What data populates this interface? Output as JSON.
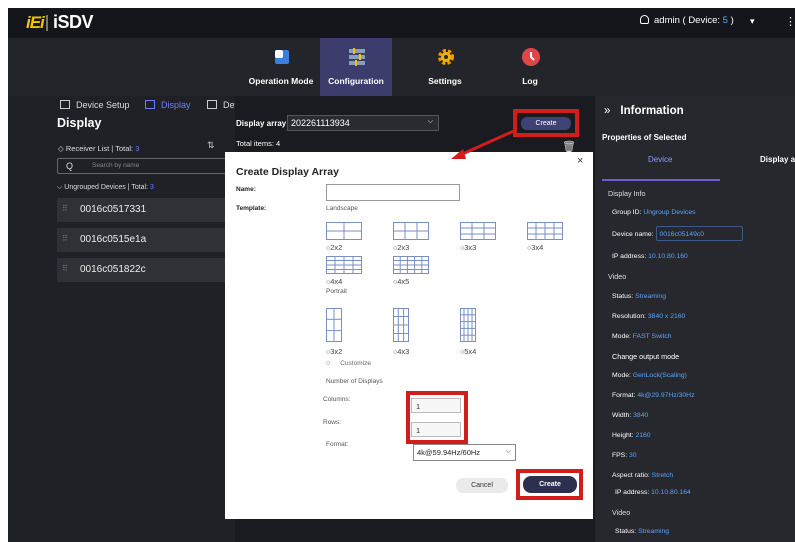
{
  "app": {
    "logo_brand": "iEi",
    "logo_product": "iSDV"
  },
  "user": {
    "name": "admin",
    "device_prefix": "( Device: ",
    "device_count": "5",
    "device_suffix": " )",
    "caret": "▾",
    "more": "⋮"
  },
  "nav": {
    "items": [
      {
        "label": "Operation Mode",
        "icon": "operation-mode-icon"
      },
      {
        "label": "Configuration",
        "icon": "configuration-icon"
      },
      {
        "label": "Settings",
        "icon": "settings-gear-icon"
      },
      {
        "label": "Log",
        "icon": "log-clock-icon"
      }
    ]
  },
  "left": {
    "tabs": [
      "Device Setup",
      "Display",
      "Device Summary"
    ],
    "title": "Display",
    "receiver_list_label": "Receiver List | Total: ",
    "receiver_total": "3",
    "search_placeholder": "Search by name",
    "ungrouped_label": "Ungrouped Devices | Total: ",
    "ungrouped_total": "3",
    "devices": [
      "0016c0517331",
      "0016c0515e1a",
      "0016c051822c"
    ]
  },
  "center": {
    "display_array_label": "Display array:",
    "display_array_value": "202261113934",
    "total_items": "Total items: 4",
    "create_label": "Create"
  },
  "modal": {
    "title": "Create Display Array",
    "close": "×",
    "name_label": "Name:",
    "template_label": "Template:",
    "landscape_label": "Landscape",
    "landscape_options": [
      "2x2",
      "2x3",
      "3x3",
      "3x4",
      "4x4",
      "4x5"
    ],
    "portrait_label": "Portrait",
    "portrait_options": [
      "3x2",
      "4x3",
      "5x4"
    ],
    "customize_label": "Customize",
    "number_label": "Number of Displays",
    "columns_label": "Columns:",
    "columns_value": "1",
    "rows_label": "Rows:",
    "rows_value": "1",
    "format_label": "Format:",
    "format_value": "4k@59.94Hz/60Hz",
    "cancel_label": "Cancel",
    "create_label": "Create"
  },
  "info": {
    "title": "Information",
    "properties_label": "Properties of Selected",
    "tab_device": "Device",
    "tab_display": "Display arr",
    "section_display_info": "Display Info",
    "group_id_label": "Group ID:",
    "group_id_value": "Ungroup Devices",
    "device_name_label": "Device name:",
    "device_name_value": "0016c05149c0",
    "ip_label": "IP address:",
    "ip_value": "10.10.80.160",
    "section_video": "Video",
    "status_label": "Status:",
    "status_value": "Streaming",
    "resolution_label": "Resolution:",
    "resolution_value": "3840 x 2160",
    "mode_label": "Mode:",
    "mode_value": "FAST Switch",
    "change_output": "Change output mode",
    "mode2_label": "Mode:",
    "mode2_value": "GenLock(Scaling)",
    "format_label": "Format:",
    "format_value": "4k@29.97Hz/30Hz",
    "width_label": "Width:",
    "width_value": "3840",
    "height_label": "Height:",
    "height_value": "2160",
    "fps_label": "FPS:",
    "fps_value": "30",
    "aspect_label": "Aspect ratio:",
    "aspect_value": "Stretch",
    "ip2_label": "IP address:",
    "ip2_value": "10.10.80.164",
    "section_video2": "Video",
    "status2_label": "Status:",
    "status2_value": "Streaming"
  },
  "colors": {
    "annotation": "#d21d1d",
    "accent": "#6c7dff",
    "nav_active": "#3c3d6d",
    "logo": "#f2c500"
  }
}
